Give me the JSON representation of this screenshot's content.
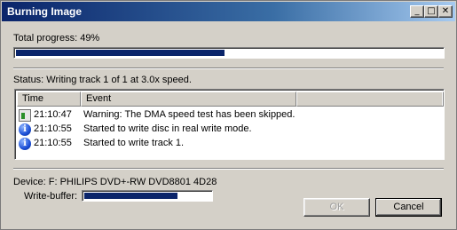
{
  "window": {
    "title": "Burning Image",
    "minimize_glyph": "_",
    "maximize_glyph": "□",
    "close_glyph": "✕"
  },
  "total_progress": {
    "label": "Total progress: 49%",
    "value": 0.49
  },
  "status": {
    "text": "Status: Writing track 1 of 1 at 3.0x speed."
  },
  "log": {
    "columns": [
      "Time",
      "Event"
    ],
    "rows": [
      {
        "icon": "warning-icon",
        "time": "21:10:47",
        "event": "Warning: The DMA speed test has been skipped."
      },
      {
        "icon": "info-icon",
        "time": "21:10:55",
        "event": "Started to write disc in real write mode."
      },
      {
        "icon": "info-icon",
        "time": "21:10:55",
        "event": "Started to write track 1."
      }
    ]
  },
  "device": {
    "text": "Device: F: PHILIPS DVD+-RW DVD8801 4D28"
  },
  "write_buffer": {
    "label": "Write-buffer:",
    "value": 0.74
  },
  "buttons": {
    "ok": "OK",
    "cancel": "Cancel"
  },
  "colors": {
    "titlebar": "#0a246a",
    "progress_fill": "#0a246a",
    "face": "#d4d0c8"
  }
}
